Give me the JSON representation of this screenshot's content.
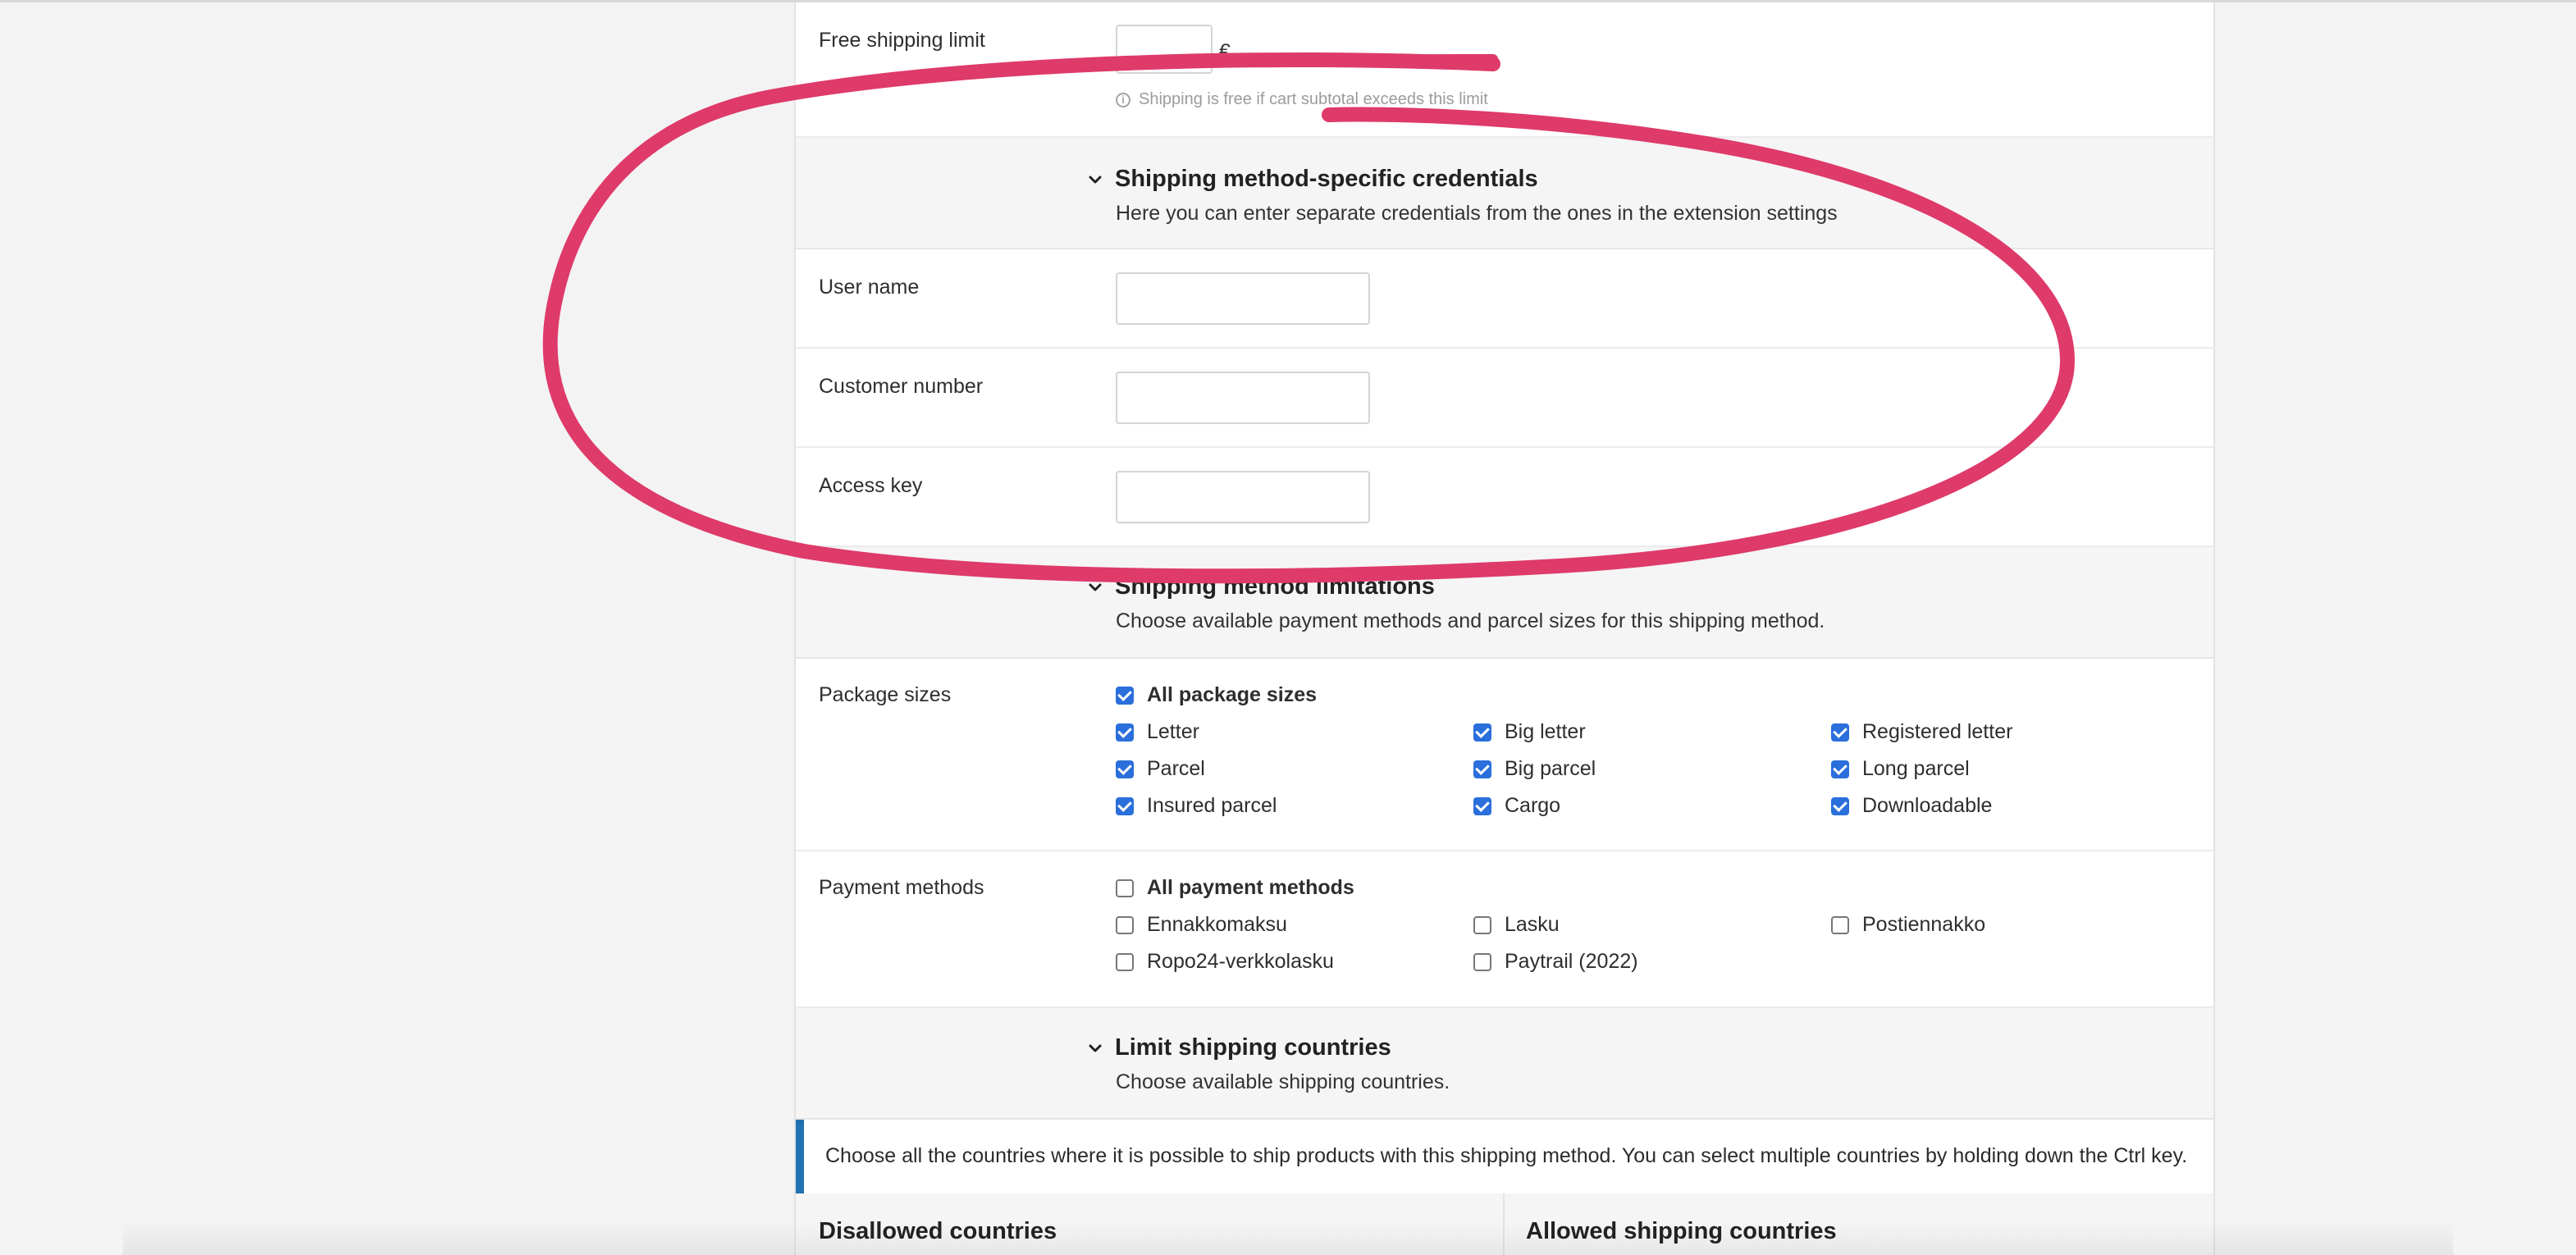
{
  "free_shipping": {
    "label": "Free shipping limit",
    "value": "",
    "currency": "€",
    "hint": "Shipping is free if cart subtotal exceeds this limit"
  },
  "credentials": {
    "title": "Shipping method-specific credentials",
    "description": "Here you can enter separate credentials from the ones in the extension settings",
    "fields": [
      {
        "label": "User name",
        "value": ""
      },
      {
        "label": "Customer number",
        "value": ""
      },
      {
        "label": "Access key",
        "value": ""
      }
    ]
  },
  "limitations": {
    "title": "Shipping method limitations",
    "description": "Choose available payment methods and parcel sizes for this shipping method."
  },
  "package_sizes": {
    "label": "Package sizes",
    "all": {
      "label": "All package sizes",
      "checked": true
    },
    "items": [
      {
        "label": "Letter",
        "checked": true
      },
      {
        "label": "Big letter",
        "checked": true
      },
      {
        "label": "Registered letter",
        "checked": true
      },
      {
        "label": "Parcel",
        "checked": true
      },
      {
        "label": "Big parcel",
        "checked": true
      },
      {
        "label": "Long parcel",
        "checked": true
      },
      {
        "label": "Insured parcel",
        "checked": true
      },
      {
        "label": "Cargo",
        "checked": true
      },
      {
        "label": "Downloadable",
        "checked": true
      }
    ]
  },
  "payment_methods": {
    "label": "Payment methods",
    "all": {
      "label": "All payment methods",
      "checked": false
    },
    "items": [
      {
        "label": "Ennakkomaksu",
        "checked": false
      },
      {
        "label": "Lasku",
        "checked": false
      },
      {
        "label": "Postiennakko",
        "checked": false
      },
      {
        "label": "Ropo24-verkkolasku",
        "checked": false
      },
      {
        "label": "Paytrail (2022)",
        "checked": false
      }
    ]
  },
  "countries": {
    "title": "Limit shipping countries",
    "description": "Choose available shipping countries.",
    "notice": "Choose all the countries where it is possible to ship products with this shipping method. You can select multiple countries by holding down the Ctrl key.",
    "disallowed_heading": "Disallowed countries",
    "allowed_heading": "Allowed shipping countries"
  },
  "colors": {
    "annotation": "#de3a6a",
    "checkbox_accent": "#2a6fdb",
    "notice_border": "#2271b1"
  }
}
